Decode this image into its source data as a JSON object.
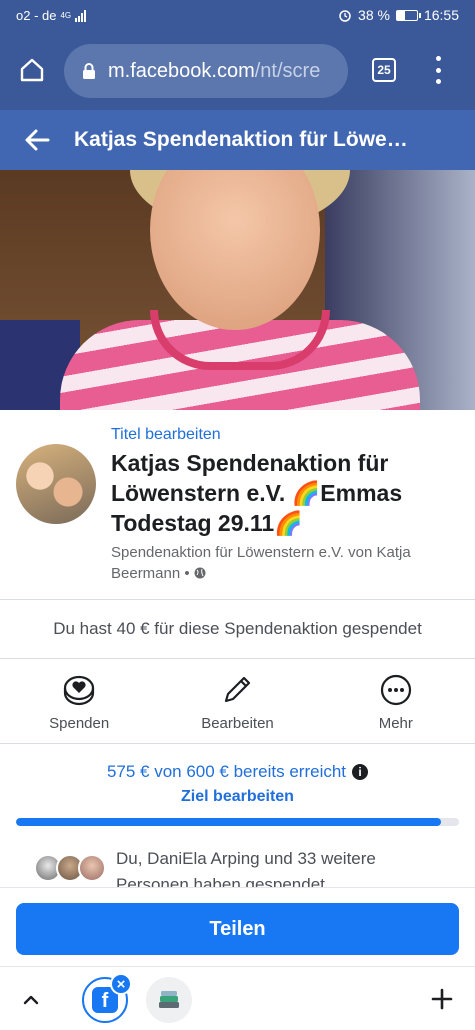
{
  "status_bar": {
    "carrier": "o2 - de",
    "network": "4G",
    "battery_percent": "38 %",
    "time": "16:55"
  },
  "browser": {
    "url_host": "m.facebook.com",
    "url_path": "/nt/scre",
    "tab_count": "25"
  },
  "header": {
    "title": "Katjas Spendenaktion für Löwe…"
  },
  "fundraiser": {
    "edit_title_link": "Titel bearbeiten",
    "title": "Katjas Spendenaktion für Löwenstern e.V. 🌈Emmas Todestag 29.11🌈",
    "subtitle": "Spendenaktion für Löwenstern e.V. von Katja Beermann •",
    "donated_notice": "Du hast 40 € für diese Spendenaktion gespendet"
  },
  "actions": [
    {
      "label": "Spenden",
      "icon": "donate-heart-coin-icon"
    },
    {
      "label": "Bearbeiten",
      "icon": "pencil-icon"
    },
    {
      "label": "Mehr",
      "icon": "more-dots-icon"
    }
  ],
  "goal": {
    "raised_text": "575 € von 600 € bereits erreicht",
    "edit_goal_link": "Ziel bearbeiten",
    "raised": 575,
    "target": 600
  },
  "donors": {
    "text": "Du, DaniEla Arping und 33 weitere Personen haben gespendet"
  },
  "share_button": "Teilen",
  "colors": {
    "browser_bar": "#3b5998",
    "fb_header": "#4267b2",
    "link_blue": "#216fdb",
    "primary_button": "#1877f2"
  }
}
